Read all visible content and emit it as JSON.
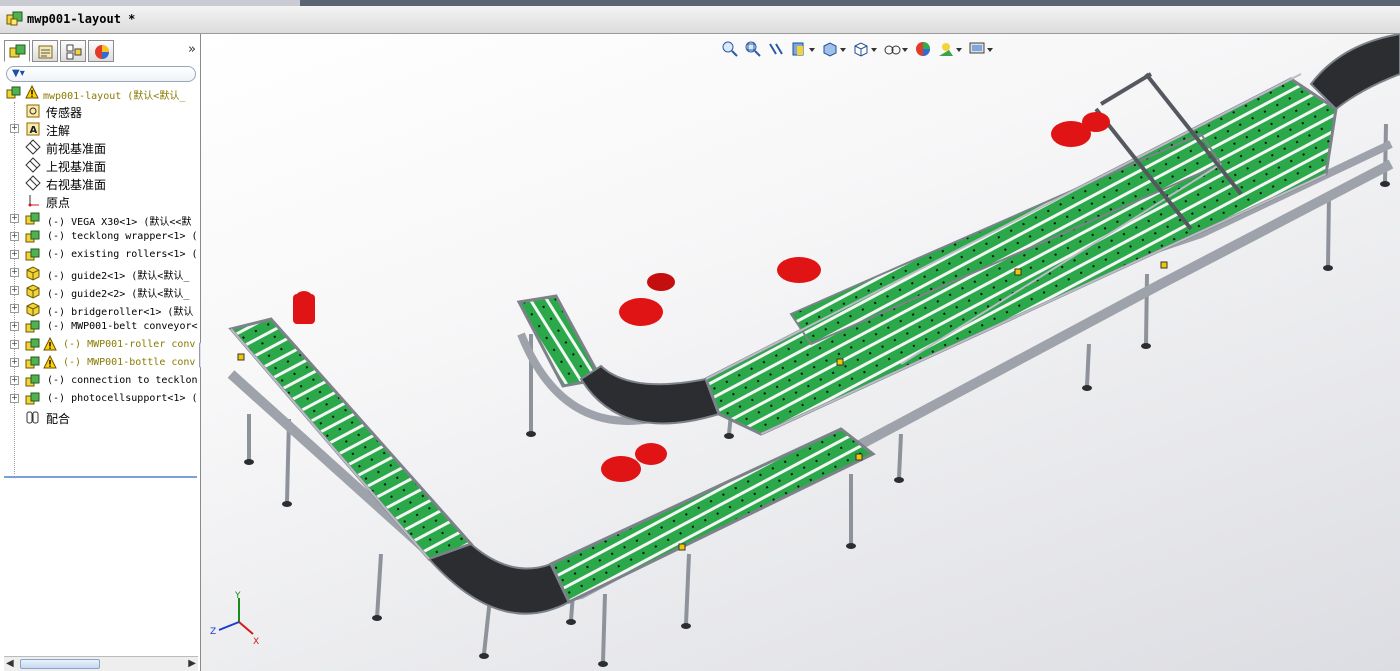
{
  "window": {
    "document_title": "mwp001-layout *"
  },
  "panel_tabs": [
    "FeatureManager",
    "PropertyManager",
    "ConfigurationManager",
    "DisplayManager"
  ],
  "tree": {
    "root": "mwp001-layout  (默认<默认_",
    "items": [
      {
        "label": "传感器",
        "icon": "sensor-icon"
      },
      {
        "label": "注解",
        "icon": "annotation-icon",
        "expandable": true
      },
      {
        "label": "前视基准面",
        "icon": "plane-icon"
      },
      {
        "label": "上视基准面",
        "icon": "plane-icon"
      },
      {
        "label": "右视基准面",
        "icon": "plane-icon"
      },
      {
        "label": "原点",
        "icon": "origin-icon"
      },
      {
        "label": "(-) VEGA X30<1> (默认<<默",
        "icon": "assembly-icon",
        "expandable": true
      },
      {
        "label": "(-) tecklong wrapper<1> (",
        "icon": "assembly-icon",
        "expandable": true
      },
      {
        "label": "(-) existing rollers<1> (",
        "icon": "assembly-icon",
        "expandable": true
      },
      {
        "label": "(-) guide2<1> (默认<默认_",
        "icon": "part-icon",
        "expandable": true
      },
      {
        "label": "(-) guide2<2> (默认<默认_",
        "icon": "part-icon",
        "expandable": true
      },
      {
        "label": "(-) bridgeroller<1> (默认",
        "icon": "part-icon",
        "expandable": true
      },
      {
        "label": "(-) MWP001-belt conveyor<",
        "icon": "assembly-icon",
        "expandable": true
      },
      {
        "label": "(-) MWP001-roller conv",
        "icon": "assembly-icon",
        "expandable": true,
        "warning": true
      },
      {
        "label": "(-) MWP001-bottle conv",
        "icon": "assembly-icon",
        "expandable": true,
        "warning": true
      },
      {
        "label": "(-) connection to tecklon",
        "icon": "assembly-icon",
        "expandable": true
      },
      {
        "label": "(-) photocellsupport<1> (",
        "icon": "assembly-icon",
        "expandable": true
      },
      {
        "label": "配合",
        "icon": "mates-icon"
      }
    ]
  },
  "view_toolbar": [
    "zoom-to-fit-icon",
    "zoom-to-area-icon",
    "previous-view-icon",
    "section-view-icon",
    "view-orientation-icon",
    "display-style-icon",
    "hide-show-icon",
    "edit-appearance-icon",
    "apply-scene-icon",
    "view-settings-icon"
  ],
  "triad": {
    "x": "X",
    "y": "Y",
    "z": "Z"
  },
  "colors": {
    "belt": "#2aa84a",
    "motor": "#e01414",
    "frame": "#9ea3ab",
    "curve": "#2b2d30"
  }
}
